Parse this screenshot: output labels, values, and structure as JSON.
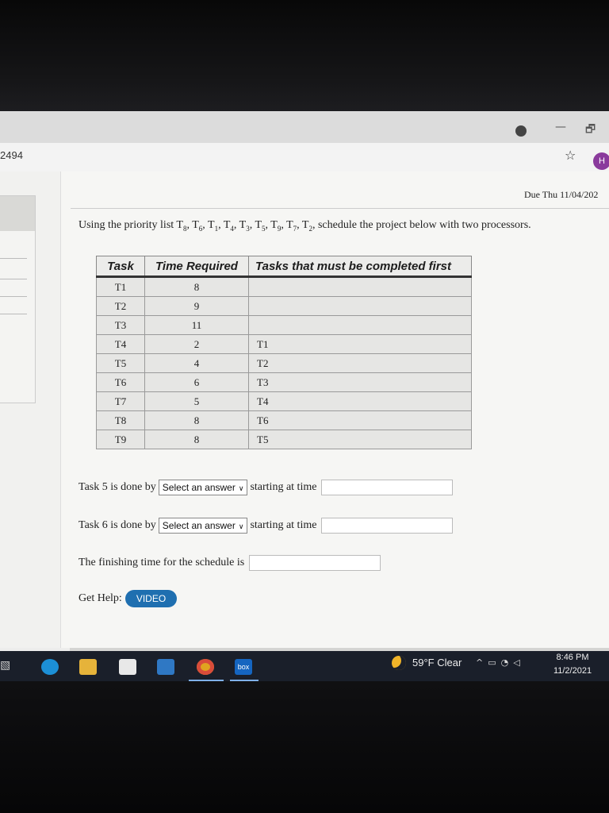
{
  "browser": {
    "url_fragment": "2494",
    "avatar_initial": "H",
    "star_symbol": "☆",
    "window_minimize": "—",
    "window_restore": "🗗"
  },
  "assignment": {
    "due": "Due Thu 11/04/202",
    "question_prefix": "Using the priority list ",
    "priority_list": [
      "T8",
      "T6",
      "T1",
      "T4",
      "T3",
      "T5",
      "T9",
      "T7",
      "T2"
    ],
    "question_suffix": ", schedule the project below with two processors."
  },
  "table": {
    "headers": [
      "Task",
      "Time Required",
      "Tasks that must be completed first"
    ],
    "rows": [
      [
        "T1",
        "8",
        ""
      ],
      [
        "T2",
        "9",
        ""
      ],
      [
        "T3",
        "11",
        ""
      ],
      [
        "T4",
        "2",
        "T1"
      ],
      [
        "T5",
        "4",
        "T2"
      ],
      [
        "T6",
        "6",
        "T3"
      ],
      [
        "T7",
        "5",
        "T4"
      ],
      [
        "T8",
        "8",
        "T6"
      ],
      [
        "T9",
        "8",
        "T5"
      ]
    ]
  },
  "answers": {
    "task5_label": "Task 5 is done by",
    "task5_select": "Select an answer",
    "task5_time_label": "starting at time",
    "task5_time_value": "",
    "task6_label": "Task 6 is done by",
    "task6_select": "Select an answer",
    "task6_time_label": "starting at time",
    "task6_time_value": "",
    "finish_label": "The finishing time for the schedule is",
    "finish_value": "",
    "help_label": "Get Help:",
    "video_label": "VIDEO"
  },
  "taskbar": {
    "weather": "59°F  Clear",
    "time": "8:46 PM",
    "date": "11/2/2021",
    "box_label": "box"
  },
  "colors": {
    "accent_button": "#1f6fb0",
    "avatar": "#8a3a9c",
    "taskbar": "#1a1f2a"
  }
}
